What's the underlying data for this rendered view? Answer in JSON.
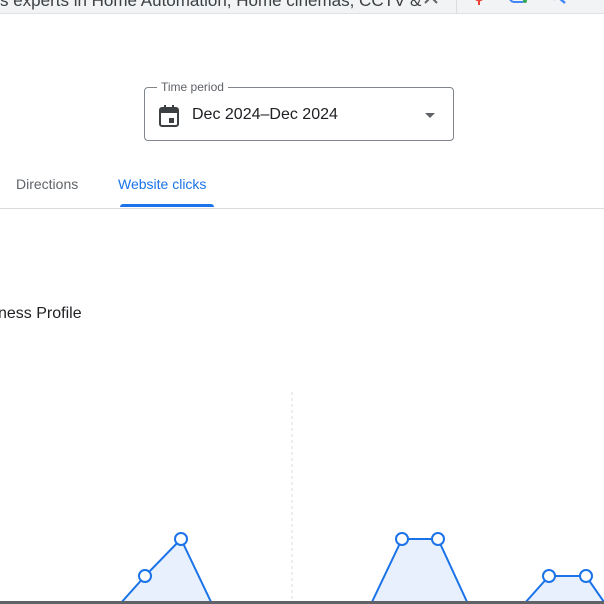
{
  "topbar": {
    "query_text": "s experts in Home Automation, Home cinemas, CCTV &",
    "icons": [
      "close-icon",
      "mic-icon",
      "lens-icon",
      "search-icon"
    ]
  },
  "time_period": {
    "label": "Time period",
    "value": "Dec 2024–Dec 2024"
  },
  "tabs": [
    {
      "label": "Directions",
      "selected": false
    },
    {
      "label": "Website clicks",
      "selected": true
    }
  ],
  "section": {
    "heading": "ness Profile"
  },
  "colors": {
    "accent": "#1a73e8",
    "chart_line": "#1a73e8",
    "chart_fill": "#e8f0fe"
  }
}
